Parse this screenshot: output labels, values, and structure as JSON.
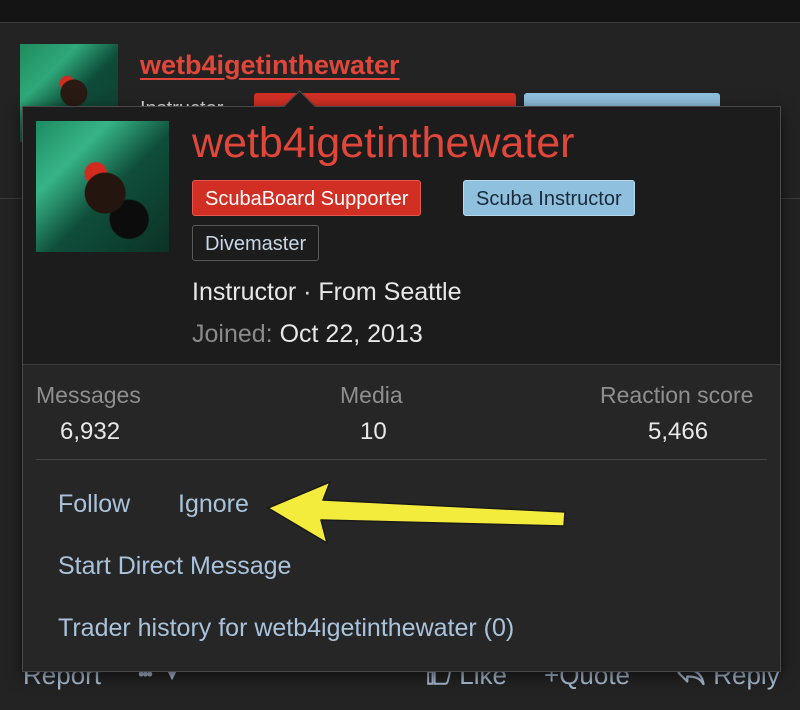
{
  "post": {
    "username": "wetb4igetinthewater",
    "userline": "Instructor",
    "badge_colors": [
      "#d12f24",
      "#8fc0dd"
    ]
  },
  "popup": {
    "username": "wetb4igetinthewater",
    "badges": [
      "ScubaBoard Supporter",
      "Scuba Instructor",
      "Divemaster"
    ],
    "blurb": "Instructor · From Seattle",
    "joined_label": "Joined:",
    "joined_date": "Oct 22, 2013",
    "stats": [
      {
        "label": "Messages",
        "value": "6,932"
      },
      {
        "label": "Media",
        "value": "10"
      },
      {
        "label": "Reaction score",
        "value": "5,466"
      }
    ],
    "actions": {
      "follow": "Follow",
      "ignore": "Ignore",
      "start_dm": "Start Direct Message",
      "trader_history": "Trader history for wetb4igetinthewater (0)"
    }
  },
  "bottom_actions": {
    "report": "Report",
    "more": "•••",
    "like": "Like",
    "quote": "Quote",
    "reply": "Reply"
  },
  "colors": {
    "username": "#e0473a",
    "link": "#a9c3dd",
    "annotation_arrow": "#f4ec3c"
  },
  "icons": [
    "chevron-down-icon",
    "thumbs-up-icon",
    "plus-icon",
    "reply-icon",
    "annotation-arrow"
  ]
}
